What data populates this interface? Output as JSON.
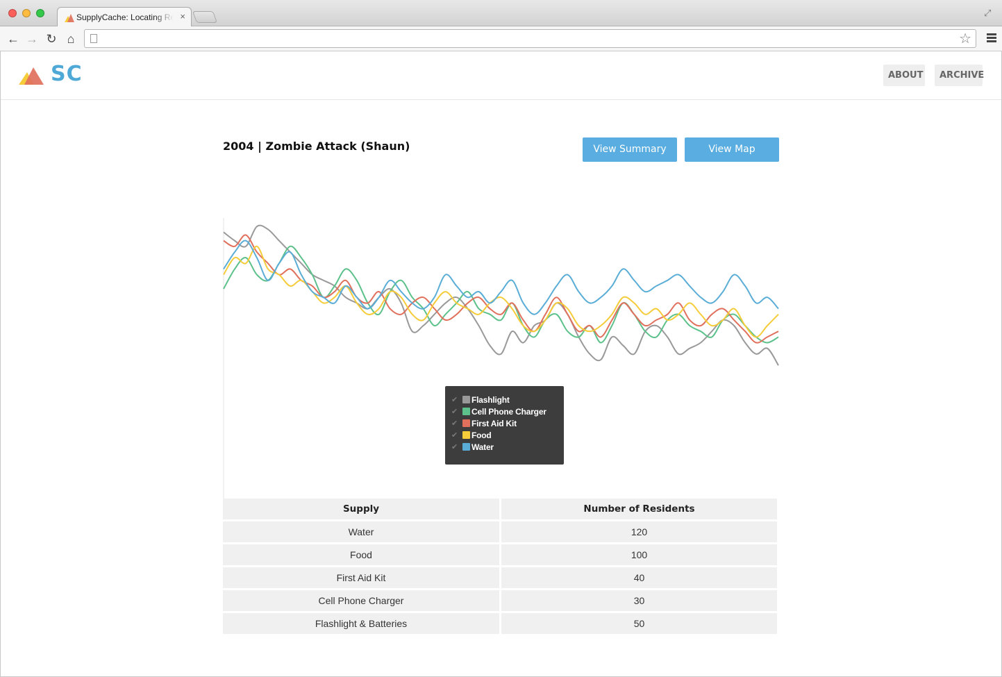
{
  "browser": {
    "tab_title": "SupplyCache: Locating Resources",
    "tab_close": "×",
    "url": ""
  },
  "header": {
    "logo_text": "SC",
    "nav": [
      {
        "label": "ABOUT"
      },
      {
        "label": "ARCHIVE"
      }
    ]
  },
  "main": {
    "title": "2004 | Zombie Attack (Shaun)",
    "buttons": {
      "summary": "View Summary",
      "map": "View Map"
    }
  },
  "legend": [
    {
      "label": "Flashlight",
      "color": "#999999"
    },
    {
      "label": "Cell Phone Charger",
      "color": "#5cc18a"
    },
    {
      "label": "First Aid Kit",
      "color": "#e0705c"
    },
    {
      "label": "Food",
      "color": "#f5cc3a"
    },
    {
      "label": "Water",
      "color": "#5aadd6"
    }
  ],
  "chart_data": {
    "type": "line",
    "title": "",
    "xlabel": "",
    "ylabel": "",
    "ylim": [
      0,
      100
    ],
    "grid": false,
    "legend_position": "bottom-center",
    "x": [
      0,
      1,
      2,
      3,
      4,
      5,
      6,
      7,
      8,
      9,
      10,
      11,
      12,
      13,
      14,
      15,
      16,
      17,
      18,
      19,
      20,
      21,
      22,
      23,
      24,
      25,
      26,
      27,
      28,
      29,
      30,
      31,
      32,
      33,
      34,
      35,
      36,
      37,
      38,
      39,
      40,
      41,
      42,
      43,
      44,
      45,
      46,
      47,
      48,
      49,
      50
    ],
    "series": [
      {
        "name": "Flashlight",
        "color": "#999999",
        "values": [
          95,
          92,
          90,
          97,
          96,
          92,
          88,
          84,
          80,
          78,
          76,
          72,
          70,
          68,
          72,
          75,
          70,
          60,
          62,
          66,
          70,
          72,
          68,
          62,
          55,
          52,
          60,
          56,
          62,
          64,
          70,
          66,
          58,
          52,
          50,
          58,
          55,
          52,
          60,
          62,
          58,
          52,
          54,
          56,
          60,
          64,
          62,
          56,
          52,
          54,
          48
        ]
      },
      {
        "name": "Cell Phone Charger",
        "color": "#5cc18a",
        "values": [
          75,
          82,
          86,
          80,
          78,
          84,
          90,
          86,
          80,
          72,
          76,
          82,
          78,
          70,
          66,
          74,
          78,
          72,
          68,
          62,
          66,
          70,
          74,
          68,
          66,
          64,
          70,
          62,
          58,
          64,
          66,
          60,
          58,
          62,
          56,
          62,
          70,
          66,
          60,
          58,
          64,
          66,
          62,
          60,
          58,
          64,
          66,
          62,
          58,
          56,
          58
        ]
      },
      {
        "name": "First Aid Kit",
        "color": "#e0705c",
        "values": [
          92,
          90,
          94,
          88,
          84,
          80,
          82,
          78,
          76,
          72,
          74,
          78,
          72,
          70,
          74,
          68,
          66,
          70,
          72,
          68,
          64,
          66,
          70,
          72,
          68,
          66,
          70,
          64,
          60,
          66,
          72,
          66,
          60,
          62,
          58,
          64,
          70,
          66,
          62,
          64,
          66,
          70,
          64,
          62,
          66,
          68,
          64,
          60,
          56,
          58,
          60
        ]
      },
      {
        "name": "Food",
        "color": "#f5cc3a",
        "values": [
          80,
          86,
          84,
          90,
          82,
          80,
          76,
          78,
          74,
          70,
          72,
          76,
          70,
          66,
          68,
          74,
          72,
          66,
          64,
          70,
          74,
          70,
          68,
          66,
          70,
          72,
          68,
          62,
          60,
          64,
          70,
          68,
          62,
          60,
          62,
          66,
          72,
          70,
          66,
          68,
          64,
          66,
          70,
          66,
          62,
          64,
          68,
          62,
          58,
          62,
          66
        ]
      },
      {
        "name": "Water",
        "color": "#5aadd6",
        "values": [
          82,
          88,
          92,
          86,
          78,
          84,
          88,
          80,
          74,
          72,
          70,
          76,
          72,
          68,
          72,
          78,
          74,
          70,
          68,
          72,
          80,
          76,
          72,
          74,
          70,
          74,
          78,
          70,
          66,
          70,
          76,
          80,
          74,
          70,
          72,
          76,
          82,
          78,
          74,
          76,
          78,
          80,
          76,
          72,
          70,
          74,
          80,
          76,
          70,
          72,
          68
        ]
      }
    ]
  },
  "table": {
    "headers": [
      "Supply",
      "Number of Residents"
    ],
    "rows": [
      [
        "Water",
        "120"
      ],
      [
        "Food",
        "100"
      ],
      [
        "First Aid Kit",
        "40"
      ],
      [
        "Cell Phone Charger",
        "30"
      ],
      [
        "Flashlight & Batteries",
        "50"
      ]
    ]
  }
}
